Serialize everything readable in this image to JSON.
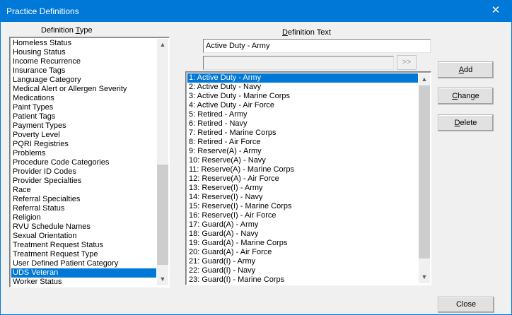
{
  "window": {
    "title": "Practice Definitions",
    "close_glyph": "✕"
  },
  "left_panel": {
    "label_prefix": "Definition ",
    "label_underlined": "T",
    "label_suffix": "ype",
    "items": [
      "Homeless Status",
      "Housing Status",
      "Income Recurrence",
      "Insurance Tags",
      "Language Category",
      "Medical Alert or Allergen Severity",
      "Medications",
      "Paint Types",
      "Patient Tags",
      "Payment Types",
      "Poverty Level",
      "PQRI Registries",
      "Problems",
      "Procedure Code Categories",
      "Provider ID Codes",
      "Provider Specialties",
      "Race",
      "Referral Specialties",
      "Referral Status",
      "Religion",
      "RVU Schedule Names",
      "Sexual Orientation",
      "Treatment Request Status",
      "Treatment Request Type",
      "User Defined Patient Category",
      "UDS Veteran",
      "Worker Status"
    ],
    "selected_index": 25,
    "scroll": {
      "position": 0.93,
      "visible_fraction": 0.45
    }
  },
  "right_panel": {
    "label_prefix": "",
    "label_underlined": "D",
    "label_suffix": "efinition Text",
    "definition_text": "Active Duty - Army",
    "secondary_text": "",
    "move_button_label": ">>",
    "items": [
      "1: Active Duty - Army",
      "2: Active Duty - Navy",
      "3: Active Duty - Marine Corps",
      "4: Active Duty - Air Force",
      "5: Retired - Army",
      "6: Retired - Navy",
      "7: Retired - Marine Corps",
      "8: Retired - Air Force",
      "9: Reserve(A) - Army",
      "10: Reserve(A) - Navy",
      "11: Reserve(A) - Marine Corps",
      "12: Reserve(A) - Air Force",
      "13: Reserve(I) - Army",
      "14: Reserve(I) - Navy",
      "15: Reserve(I) - Marine Corps",
      "16: Reserve(I) - Air Force",
      "17: Guard(A) - Army",
      "18: Guard(A) - Navy",
      "19: Guard(A) - Marine Corps",
      "20: Guard(A) - Air Force",
      "21: Guard(I) - Army",
      "22: Guard(I) - Navy",
      "23: Guard(I) - Marine Corps"
    ],
    "selected_index": 0,
    "scroll": {
      "position": 0.0,
      "visible_fraction": 0.93
    }
  },
  "buttons": {
    "add": {
      "underlined": "A",
      "rest": "dd"
    },
    "change": {
      "underlined": "C",
      "rest": "hange"
    },
    "delete": {
      "underlined": "D",
      "rest": "elete"
    },
    "close": "Close"
  },
  "colors": {
    "accent": "#0078d7",
    "selection": "#0078d7"
  }
}
